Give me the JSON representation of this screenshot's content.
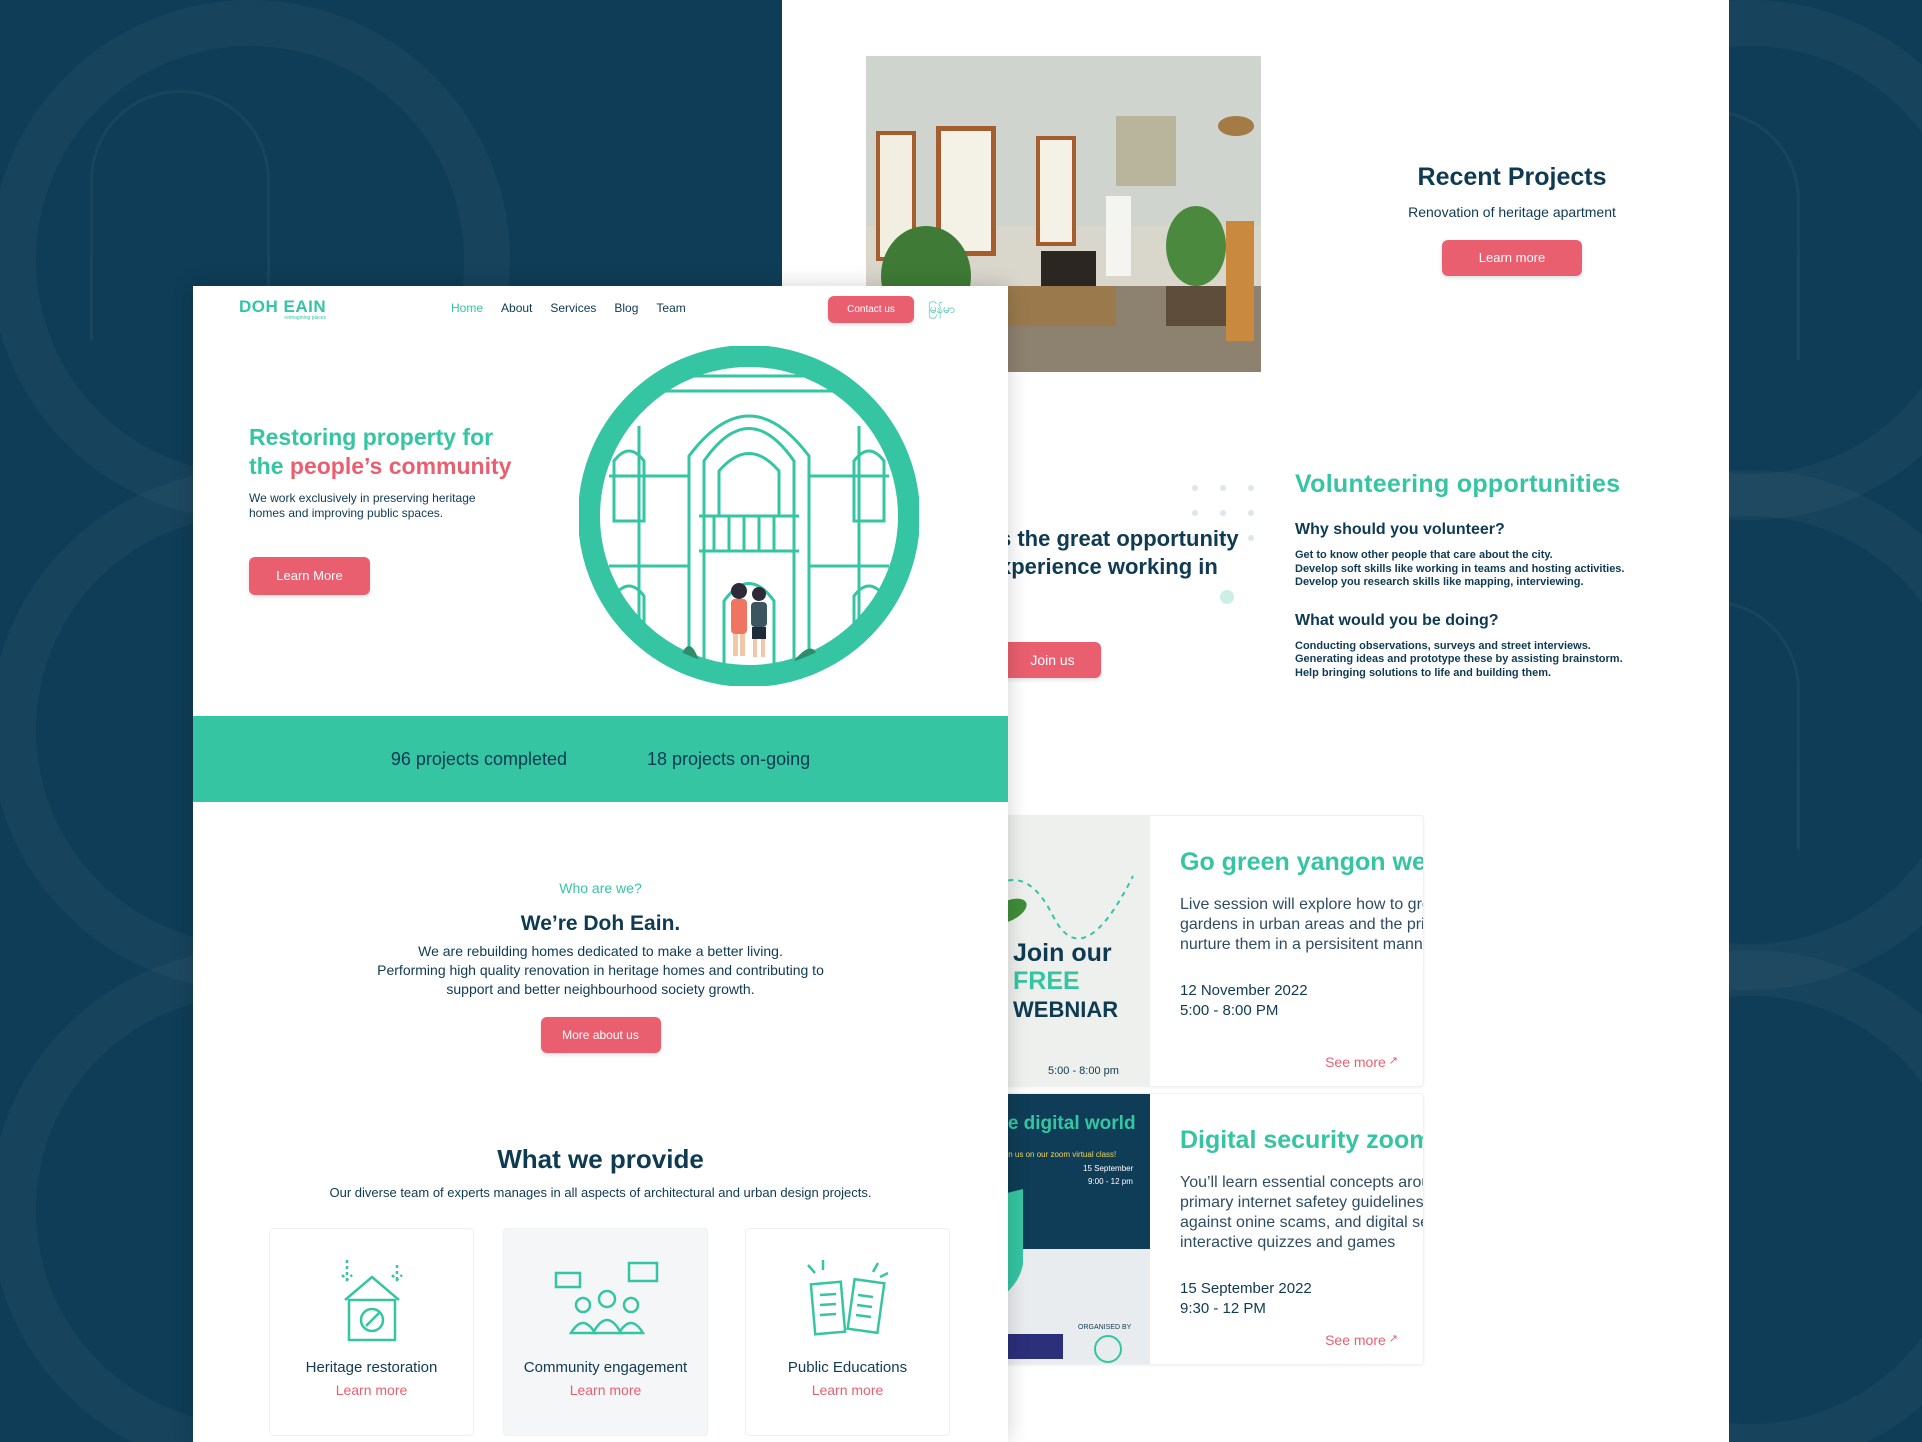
{
  "nav": {
    "logo": "DOH EAIN",
    "logo_tagline": "reimagining places",
    "items": [
      "Home",
      "About",
      "Services",
      "Blog",
      "Team"
    ],
    "contact": "Contact us",
    "language": "မြန်မာ"
  },
  "hero": {
    "title_line1": "Restoring property for",
    "title_the": "the ",
    "title_highlight": "people’s community",
    "text": "We work exclusively in preserving heritage homes and improving public spaces.",
    "button": "Learn More"
  },
  "stats": {
    "completed": "96 projects completed",
    "ongoing": "18 projects on-going"
  },
  "who": {
    "kicker": "Who are we?",
    "title": "We’re Doh Eain.",
    "text": "We are rebuilding homes dedicated to make a better living.\nPerforming high quality renovation in heritage homes and contributing to\nsupport and better neighbourhood society growth.",
    "button": "More about us"
  },
  "provide": {
    "title": "What we provide",
    "subtitle": "Our diverse team of experts manages in all aspects of architectural and urban design projects.",
    "cards": [
      {
        "title": "Heritage restoration",
        "link": "Learn more",
        "icon": "house-repair-icon"
      },
      {
        "title": "Community engagement",
        "link": "Learn more",
        "icon": "people-chat-icon"
      },
      {
        "title": "Public Educations",
        "link": "Learn more",
        "icon": "books-icon"
      }
    ]
  },
  "recent": {
    "title": "Recent Projects",
    "subtitle": "Renovation of heritage apartment",
    "button": "Learn more"
  },
  "volunteer": {
    "lead_line1": "s the great opportunity",
    "lead_line2": "xperience working in",
    "join": "Join us",
    "title": "Volunteering  opportunities",
    "why_title": "Why should you volunteer?",
    "why_text": "Get to know other people that care about the city.\nDevelop soft skills like working in teams and hosting activities.\nDevelop you research skills like mapping, interviewing.",
    "doing_title": "What would you be doing?",
    "doing_text": "Conducting observations, surveys and street interviews.\nGenerating ideas and prototype these by assisting brainstorm.\nHelp bringing solutions to life and building them."
  },
  "events": [
    {
      "title": "Go green yangon webinar",
      "desc": "Live session will explore how to grow plants and gardens in urban areas and the primary ways to nurture them in a persisitent manner",
      "date": "12 November 2022",
      "time": "5:00 - 8:00 PM",
      "link": "See more",
      "poster_line1": "Join our",
      "poster_line2": "FREE",
      "poster_line3": "WEBNIAR",
      "poster_time": "5:00 - 8:00 pm"
    },
    {
      "title": "Digital security zoom class",
      "desc": "You’ll learn essential concepts around key topics llike primary internet safetey guidelines, safeguarding against onine scams, and digital security using interactive quizzes and games",
      "date": "15 September 2022",
      "time": "9:30 - 12 PM",
      "link": "See more",
      "poster_title": "n the digital world",
      "poster_sub": "Join us on our  zoom virtual class!",
      "poster_date": "15 September",
      "poster_time": "9:00 - 12 pm",
      "poster_org": "ORGANISED BY"
    }
  ],
  "colors": {
    "teal": "#35c5a2",
    "pink": "#ea5f6f",
    "navy": "#0e3a52",
    "background": "#0f3d57"
  }
}
